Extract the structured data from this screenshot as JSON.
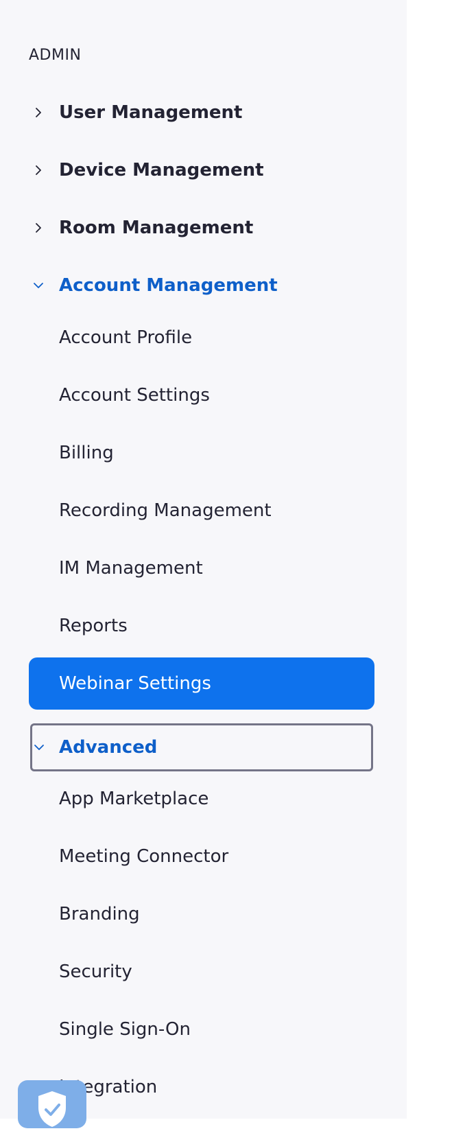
{
  "sidebar": {
    "section_label": "ADMIN",
    "items": [
      {
        "label": "User Management"
      },
      {
        "label": "Device Management"
      },
      {
        "label": "Room Management"
      },
      {
        "label": "Account Management"
      },
      {
        "label": "Account Profile"
      },
      {
        "label": "Account Settings"
      },
      {
        "label": "Billing"
      },
      {
        "label": "Recording Management"
      },
      {
        "label": "IM Management"
      },
      {
        "label": "Reports"
      },
      {
        "label": "Webinar Settings"
      },
      {
        "label": "Advanced"
      },
      {
        "label": "App Marketplace"
      },
      {
        "label": "Meeting Connector"
      },
      {
        "label": "Branding"
      },
      {
        "label": "Security"
      },
      {
        "label": "Single Sign-On"
      },
      {
        "label": "Integration"
      }
    ]
  },
  "icons": {
    "collapsed_group": "chevron-right-icon",
    "expanded_group": "chevron-down-icon",
    "badge": "shield-check-icon"
  },
  "colors": {
    "sidebar_bg": "#f7f7fa",
    "text": "#232333",
    "expanded_text": "#0e5fc9",
    "active_bg": "#0e72ed",
    "focus_border": "#747487",
    "badge_bg": "#7eaee8"
  }
}
